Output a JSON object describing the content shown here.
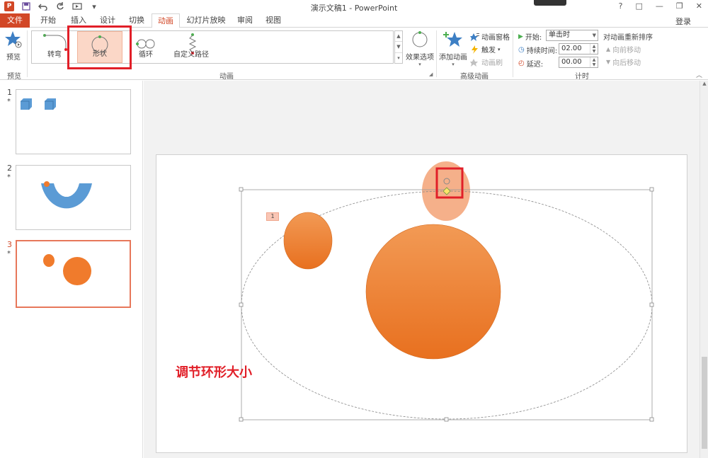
{
  "window": {
    "title": "演示文稿1 - PowerPoint",
    "controls": [
      "?",
      "□",
      "—",
      "❐",
      "✕"
    ]
  },
  "tabs": {
    "file": "文件",
    "items": [
      "开始",
      "插入",
      "设计",
      "切换",
      "动画",
      "幻灯片放映",
      "审阅",
      "视图"
    ],
    "active": "动画",
    "login": "登录"
  },
  "ribbon": {
    "preview": {
      "label": "预览",
      "group": "预览"
    },
    "gallery": {
      "items": [
        {
          "label": "转弯",
          "icon": "turn-path-icon"
        },
        {
          "label": "形状",
          "icon": "circle-path-icon",
          "selected": true
        },
        {
          "label": "循环",
          "icon": "loop-path-icon"
        },
        {
          "label": "自定义路径",
          "icon": "custom-path-icon"
        }
      ],
      "group": "动画"
    },
    "effect_options": "效果选项",
    "advanced": {
      "add_animation": "添加动画",
      "animation_pane": "动画窗格",
      "trigger": "触发",
      "painter": "动画刷",
      "group": "高级动画"
    },
    "timing": {
      "start_label": "开始:",
      "start_value": "单击时",
      "duration_label": "持续时间:",
      "duration_value": "02.00",
      "delay_label": "延迟:",
      "delay_value": "00.00",
      "reorder": "对动画重新排序",
      "move_earlier": "向前移动",
      "move_later": "向后移动",
      "group": "计时"
    },
    "tooltip": "形状"
  },
  "thumbnails": [
    {
      "number": "1",
      "star": "*"
    },
    {
      "number": "2",
      "star": "*"
    },
    {
      "number": "3",
      "star": "*",
      "active": true
    }
  ],
  "slide": {
    "anim_tag": "1",
    "caption": "调节环形大小"
  },
  "colors": {
    "accent": "#d24726",
    "orange": "#f07b2c",
    "highlight_red": "#e11f28",
    "blue_shape": "#5b9bd5"
  }
}
